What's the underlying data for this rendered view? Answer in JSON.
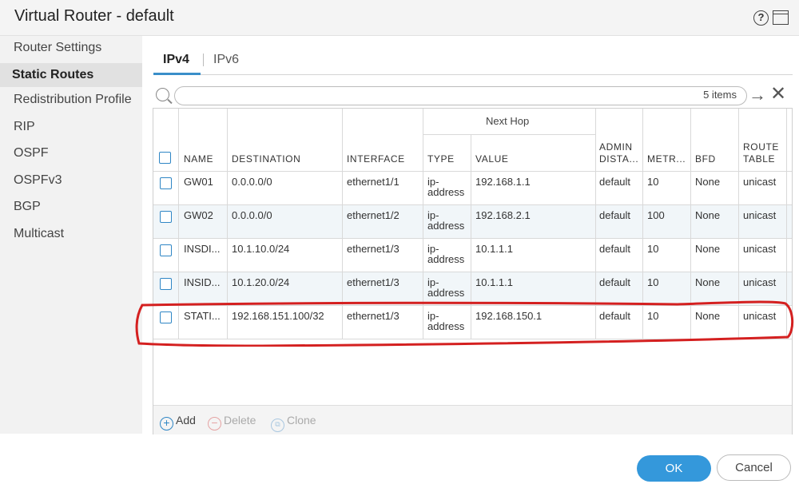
{
  "window": {
    "title": "Virtual Router - default"
  },
  "sidebar": {
    "items": [
      {
        "label": "Router Settings"
      },
      {
        "label": "Static Routes"
      },
      {
        "label": "Redistribution Profile"
      },
      {
        "label": "RIP"
      },
      {
        "label": "OSPF"
      },
      {
        "label": "OSPFv3"
      },
      {
        "label": "BGP"
      },
      {
        "label": "Multicast"
      }
    ],
    "active": "Static Routes"
  },
  "tabs": [
    {
      "label": "IPv4"
    },
    {
      "label": "IPv6"
    }
  ],
  "search": {
    "placeholder": "",
    "count": "5 items"
  },
  "table": {
    "group_header": "Next Hop",
    "headers": {
      "name": "NAME",
      "destination": "DESTINATION",
      "interface": "INTERFACE",
      "type": "TYPE",
      "value": "VALUE",
      "admin_1": "ADMIN",
      "admin_2": "DISTA...",
      "metric": "METR...",
      "bfd": "BFD",
      "route_1": "ROUTE",
      "route_2": "TABLE"
    },
    "rows": [
      {
        "name": "GW01",
        "destination": "0.0.0.0/0",
        "interface": "ethernet1/1",
        "type_1": "ip-",
        "type_2": "address",
        "value": "192.168.1.1",
        "admin": "default",
        "metric": "10",
        "bfd": "None",
        "route_table": "unicast"
      },
      {
        "name": "GW02",
        "destination": "0.0.0.0/0",
        "interface": "ethernet1/2",
        "type_1": "ip-",
        "type_2": "address",
        "value": "192.168.2.1",
        "admin": "default",
        "metric": "100",
        "bfd": "None",
        "route_table": "unicast"
      },
      {
        "name": "INSDI...",
        "destination": "10.1.10.0/24",
        "interface": "ethernet1/3",
        "type_1": "ip-",
        "type_2": "address",
        "value": "10.1.1.1",
        "admin": "default",
        "metric": "10",
        "bfd": "None",
        "route_table": "unicast"
      },
      {
        "name": "INSID...",
        "destination": "10.1.20.0/24",
        "interface": "ethernet1/3",
        "type_1": "ip-",
        "type_2": "address",
        "value": "10.1.1.1",
        "admin": "default",
        "metric": "10",
        "bfd": "None",
        "route_table": "unicast"
      },
      {
        "name": "STATI...",
        "destination": "192.168.151.100/32",
        "interface": "ethernet1/3",
        "type_1": "ip-",
        "type_2": "address",
        "value": "192.168.150.1",
        "admin": "default",
        "metric": "10",
        "bfd": "None",
        "route_table": "unicast"
      }
    ]
  },
  "footer": {
    "add": "Add",
    "delete": "Delete",
    "clone": "Clone"
  },
  "dialog": {
    "ok": "OK",
    "cancel": "Cancel"
  },
  "colors": {
    "accent": "#3498db",
    "highlight_stroke": "#d42020",
    "checkbox": "#2f86c5"
  }
}
